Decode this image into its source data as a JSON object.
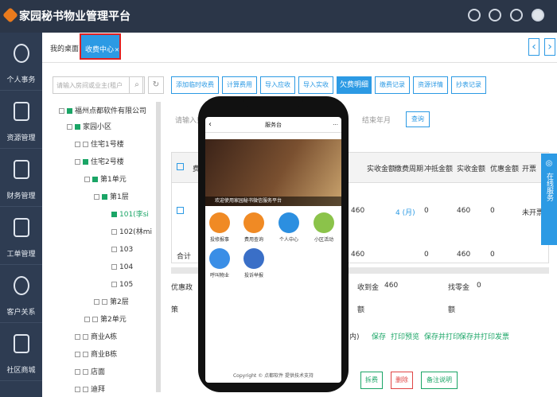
{
  "app": {
    "title": "家园秘书物业管理平台"
  },
  "sidebar": {
    "items": [
      {
        "label": "个人事务"
      },
      {
        "label": "资源管理"
      },
      {
        "label": "财务管理"
      },
      {
        "label": "工单管理"
      },
      {
        "label": "客户关系"
      },
      {
        "label": "社区商城"
      }
    ]
  },
  "tabs": {
    "home": "我的桌面",
    "active": "收费中心",
    "close": "✕",
    "prev": "‹",
    "next": "›"
  },
  "search": {
    "placeholder": "请输入房间或业主(租户"
  },
  "tree": [
    {
      "label": "福州点都软件有限公司"
    },
    {
      "label": "家园小区"
    },
    {
      "label": "住宅1号楼"
    },
    {
      "label": "住宅2号楼"
    },
    {
      "label": "第1单元"
    },
    {
      "label": "第1层"
    },
    {
      "label": "101(李si"
    },
    {
      "label": "102(林mi"
    },
    {
      "label": "103"
    },
    {
      "label": "104"
    },
    {
      "label": "105"
    },
    {
      "label": "第2层"
    },
    {
      "label": "第2单元"
    },
    {
      "label": "商业A栋"
    },
    {
      "label": "商业B栋"
    },
    {
      "label": "店面"
    },
    {
      "label": "迪拜"
    }
  ],
  "toolbar": [
    "添加临时收费",
    "计算费用",
    "导入应收",
    "导入实收",
    "欠费明细",
    "缴费记录",
    "资源详情",
    "抄表记录"
  ],
  "filter": {
    "input_placeholder": "请输入费",
    "month_placeholder": "结束年月",
    "query": "查询"
  },
  "table": {
    "headers": [
      "费",
      "实收金额",
      "缴费周期",
      "冲抵金额",
      "实收金额",
      "优惠金额",
      "开票"
    ],
    "row": {
      "amount": "460",
      "period": "4 (月)",
      "offset": "0",
      "paid": "460",
      "discount": "0",
      "invoice": "未开票"
    },
    "total": {
      "label": "合计",
      "amount": "460",
      "offset": "0",
      "paid": "460",
      "discount": "0"
    }
  },
  "form": {
    "discount_label": "优惠政",
    "received_label": "收到金",
    "received_value": "460",
    "change_label": "找零金",
    "change_value": "0",
    "policy_label": "策",
    "amount_label1": "额",
    "amount_label2": "额",
    "paren": "内)"
  },
  "actions": {
    "save": "保存",
    "print_preview": "打印预览",
    "save_print": "保存并打印",
    "save_print_invoice": "保存并打印发票"
  },
  "buttons": {
    "split": "拆费",
    "delete": "删除",
    "note": "备注说明"
  },
  "online": {
    "label": "在线服务"
  },
  "phone": {
    "header": "服务台",
    "back": "‹",
    "more": "···",
    "caption": "欢迎使用家园秘书微信服务平台",
    "icons": [
      {
        "label": "投修报事",
        "color": "#f08a24"
      },
      {
        "label": "费用查询",
        "color": "#f08a24"
      },
      {
        "label": "个人中心",
        "color": "#2c8fe0"
      },
      {
        "label": "小区活动",
        "color": "#8bc34a"
      },
      {
        "label": "呼叫物业",
        "color": "#3a8ee6"
      },
      {
        "label": "投诉举报",
        "color": "#3a6fc7"
      }
    ],
    "footer": "Copyright © 点都软件 提供技术支持"
  }
}
